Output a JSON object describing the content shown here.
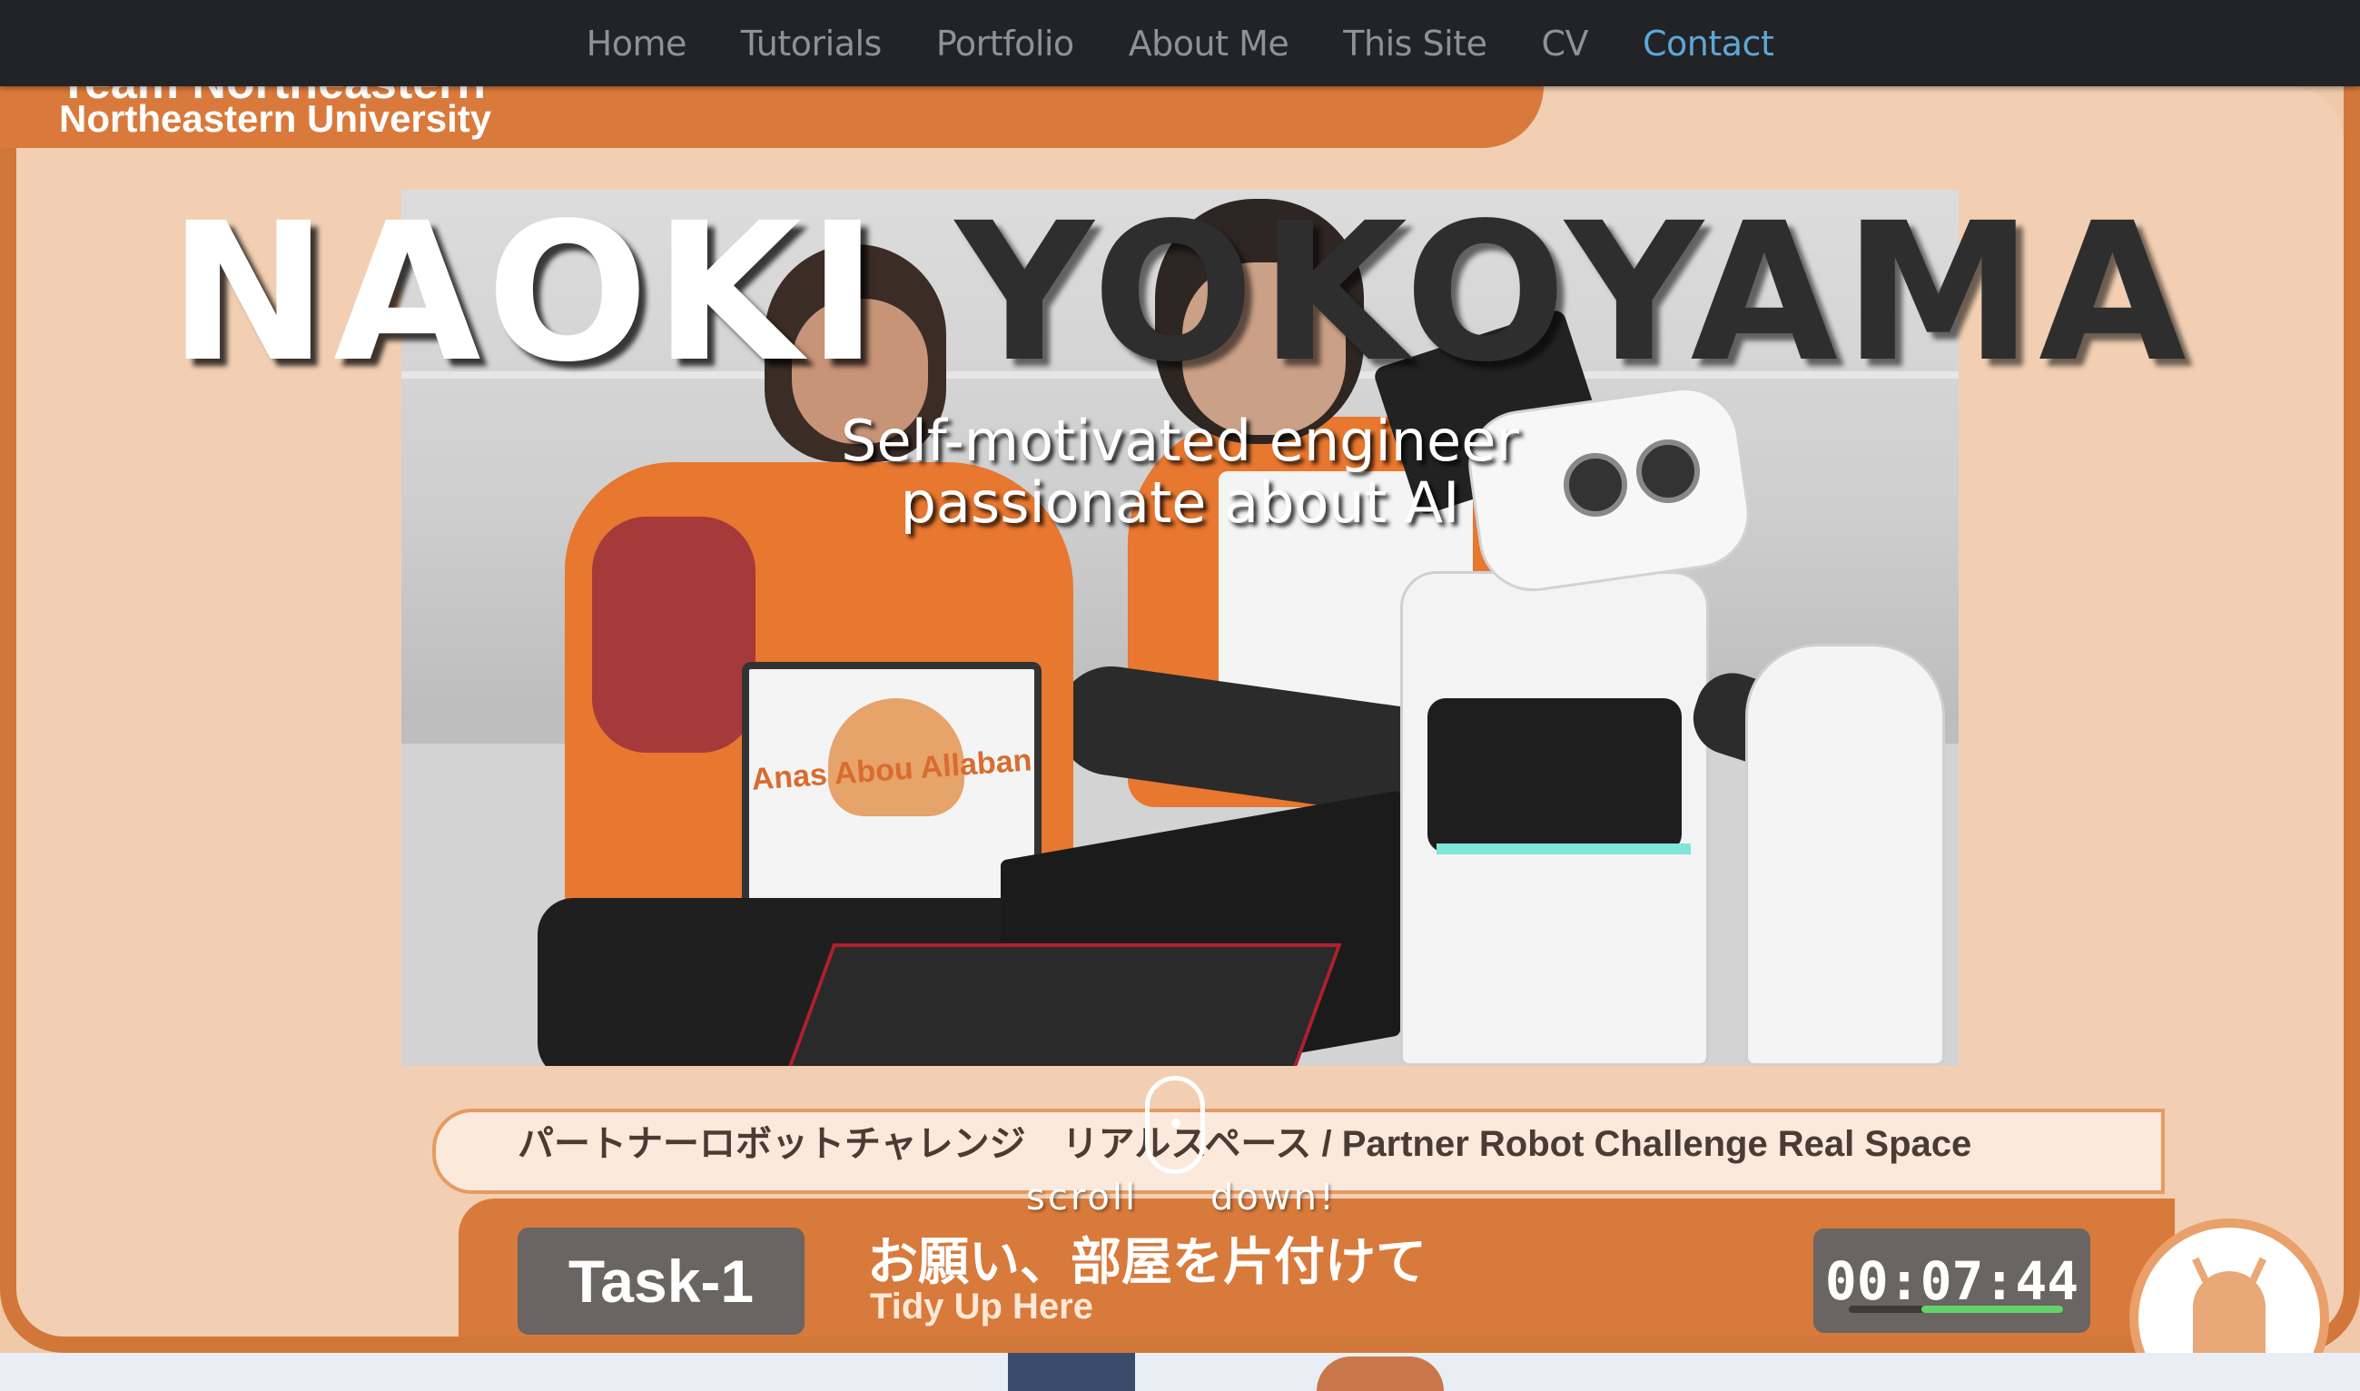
{
  "nav": {
    "items": [
      {
        "label": "Home"
      },
      {
        "label": "Tutorials"
      },
      {
        "label": "Portfolio"
      },
      {
        "label": "About Me"
      },
      {
        "label": "This Site"
      },
      {
        "label": "CV"
      },
      {
        "label": "Contact"
      }
    ],
    "active_color": "#5fa6d8"
  },
  "hero": {
    "title_first": "NAOKI",
    "title_last": "YOKOYAMA",
    "subtitle_line1": "Self-motivated engineer",
    "subtitle_line2": "passionate about AI",
    "scroll_left": "scroll",
    "scroll_right": "down!",
    "scroll_icon": "mouse-scroll-icon"
  },
  "video": {
    "team_line": "Team Northeastern",
    "university": "Northeastern University",
    "bib_name": "Anas Abou Allaban",
    "challenge_title": "パートナーロボットチャレンジ　リアルスペース / Partner Robot Challenge Real Space",
    "task_label": "Task-1",
    "task_jp": "お願い、部屋を片付けて",
    "task_en": "Tidy Up Here",
    "timer": "00:07:44",
    "accent_color": "#d87a3b"
  }
}
